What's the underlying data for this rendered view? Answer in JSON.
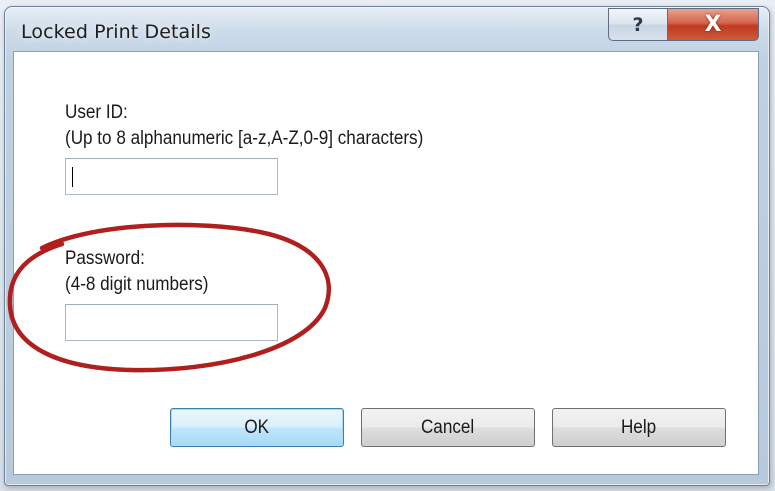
{
  "window": {
    "title": "Locked Print Details",
    "help_glyph": "?",
    "close_glyph": "X"
  },
  "form": {
    "user_id_label": "User ID:",
    "user_id_hint": "(Up to 8 alphanumeric [a-z,A-Z,0-9] characters)",
    "user_id_value": "",
    "password_label": "Password:",
    "password_hint": "(4-8 digit numbers)",
    "password_value": ""
  },
  "buttons": {
    "ok": "OK",
    "cancel": "Cancel",
    "help": "Help"
  },
  "annotation": {
    "color": "#b01e1e"
  },
  "colors": {
    "close_button": "#c1391e",
    "default_button_border": "#3c7fb1"
  }
}
